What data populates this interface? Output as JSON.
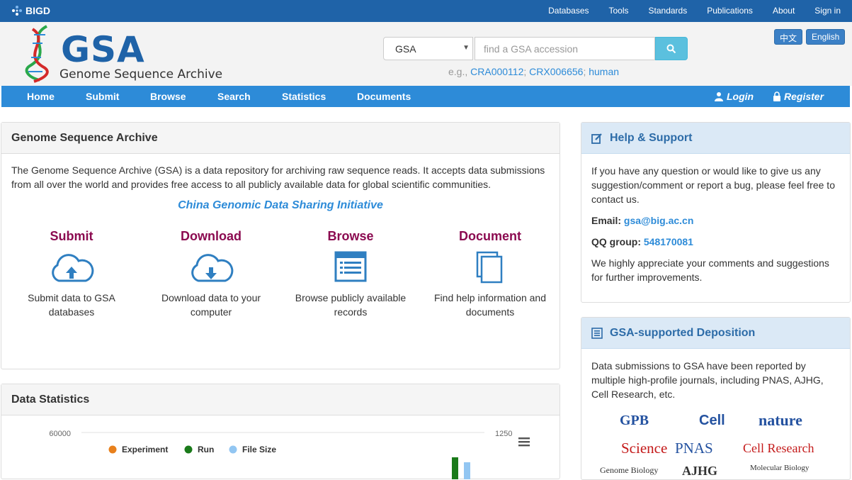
{
  "topbar": {
    "brand": "BIGD",
    "links": [
      "Databases",
      "Tools",
      "Standards",
      "Publications",
      "About",
      "Sign in"
    ]
  },
  "header": {
    "logo_title": "GSA",
    "logo_subtitle": "Genome Sequence Archive",
    "db_select": "GSA",
    "search_placeholder": "find a GSA accession",
    "example_prefix": "e.g.,",
    "examples": [
      "CRA000112",
      "CRX006656",
      "human"
    ],
    "lang_zh": "中文",
    "lang_en": "English"
  },
  "nav": {
    "items": [
      "Home",
      "Submit",
      "Browse",
      "Search",
      "Statistics",
      "Documents"
    ],
    "login": "Login",
    "register": "Register"
  },
  "main": {
    "title": "Genome Sequence Archive",
    "intro": "The Genome Sequence Archive (GSA) is a data repository for archiving raw sequence reads. It accepts data submissions from all over the world and provides free access to all publicly available data for global scientific communities.",
    "initiative": "China Genomic Data Sharing Initiative",
    "features": [
      {
        "title": "Submit",
        "desc": "Submit data to GSA databases"
      },
      {
        "title": "Download",
        "desc": "Download data to your computer"
      },
      {
        "title": "Browse",
        "desc": "Browse publicly available records"
      },
      {
        "title": "Document",
        "desc": "Find help information and documents"
      }
    ]
  },
  "stats": {
    "title": "Data Statistics",
    "chart_data": {
      "type": "bar",
      "ytick_left": "60000",
      "ytick_right": "1250",
      "series": [
        {
          "name": "Experiment",
          "color": "#e8801c"
        },
        {
          "name": "Run",
          "color": "#1a7a1a"
        },
        {
          "name": "File Size",
          "color": "#92c6f2"
        }
      ]
    }
  },
  "help": {
    "title": "Help & Support",
    "text": "If you have any question or would like to give us any suggestion/comment or report a bug, please feel free to contact us.",
    "email_label": "Email:",
    "email": "gsa@big.ac.cn",
    "qq_label": "QQ group:",
    "qq": "548170081",
    "appreciate": "We highly appreciate your comments and suggestions for further improvements."
  },
  "deposition": {
    "title": "GSA-supported Deposition",
    "text": "Data submissions to GSA have been reported by multiple high-profile journals, including PNAS, AJHG, Cell Research, etc.",
    "journals": [
      "GPB",
      "Cell",
      "nature",
      "Science",
      "PNAS",
      "Cell Research",
      "Genome Biology",
      "AJHG",
      "Molecular Biology"
    ]
  },
  "colors": {
    "topbar": "#1f63a8",
    "nav": "#2d8bd8",
    "link": "#2d8bd8",
    "feature_title": "#8b0a50"
  }
}
